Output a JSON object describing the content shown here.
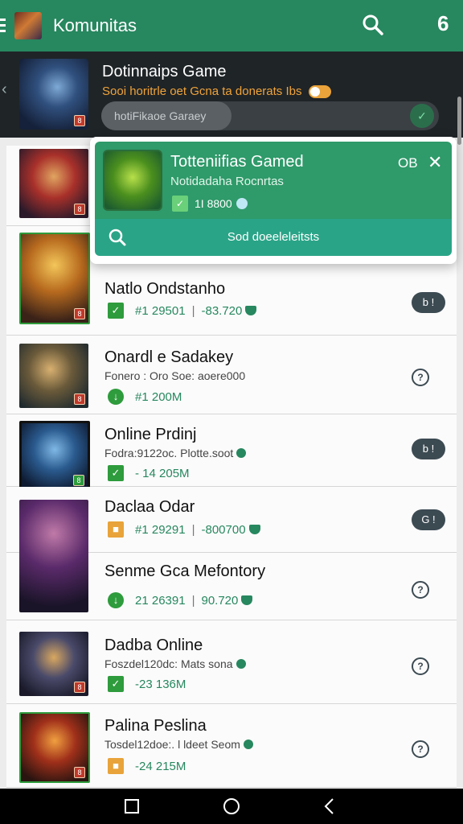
{
  "appbar": {
    "title": "Komunitas",
    "notification_count": "6",
    "icons": [
      "menu-icon",
      "search-icon"
    ]
  },
  "featured": {
    "title": "Dotinnaips Game",
    "subtitle": "Sooi horitrle oet Gcna ta donerats Ibs",
    "search_chip": "hotiFikaoe Garaey"
  },
  "popup": {
    "title": "Totteniifias Gamed",
    "subtitle": "Notidadaha Rocnrtas",
    "stat": "1I 8800",
    "count": "OB",
    "bar_label": "Sod doeeleleitsts"
  },
  "rows": [
    {
      "title": "Natlo Ondstanho",
      "subtitle": "",
      "stat1": "#1 29501",
      "stat2": "-83.720",
      "action": "pill",
      "action_label": "b !",
      "icon_style": "check"
    },
    {
      "title": "Onardl e Sadakey",
      "subtitle": "Fonero : Oro Soe: aoere000",
      "stat1": "#1 200M",
      "stat2": "",
      "action": "info",
      "action_label": "?",
      "icon_style": "circle"
    },
    {
      "title": "Online Prdinj",
      "subtitle": "Fodra:9122oc. Plotte.soot",
      "stat1": "- 14 205M",
      "stat2": "",
      "action": "pill",
      "action_label": "b !",
      "icon_style": "check"
    },
    {
      "title": "Daclaa Odar",
      "subtitle": "",
      "stat1": "#1 29291",
      "stat2": "-800700",
      "action": "pill",
      "action_label": "G !",
      "icon_style": "gold"
    },
    {
      "title": "Senme Gca Mefontory",
      "subtitle": "",
      "stat1": "21 26391",
      "stat2": "90.720",
      "action": "info",
      "action_label": "?",
      "icon_style": "circle"
    },
    {
      "title": "Dadba Online",
      "subtitle": "Foszdel120dc: Mats sona",
      "stat1": "-23 136M",
      "stat2": "",
      "action": "info",
      "action_label": "?",
      "icon_style": "check"
    },
    {
      "title": "Palina Peslina",
      "subtitle": "Tosdel12doe:. l ldeet Seom",
      "stat1": "-24 215M",
      "stat2": "",
      "action": "info",
      "action_label": "?",
      "icon_style": "gold"
    }
  ],
  "navbar": [
    "recents-icon",
    "home-icon",
    "back-icon"
  ],
  "colors": {
    "accent": "#27875f",
    "popup_top": "#2f9a6a",
    "popup_bar": "#2aa487",
    "header_dark": "#1f2427"
  }
}
